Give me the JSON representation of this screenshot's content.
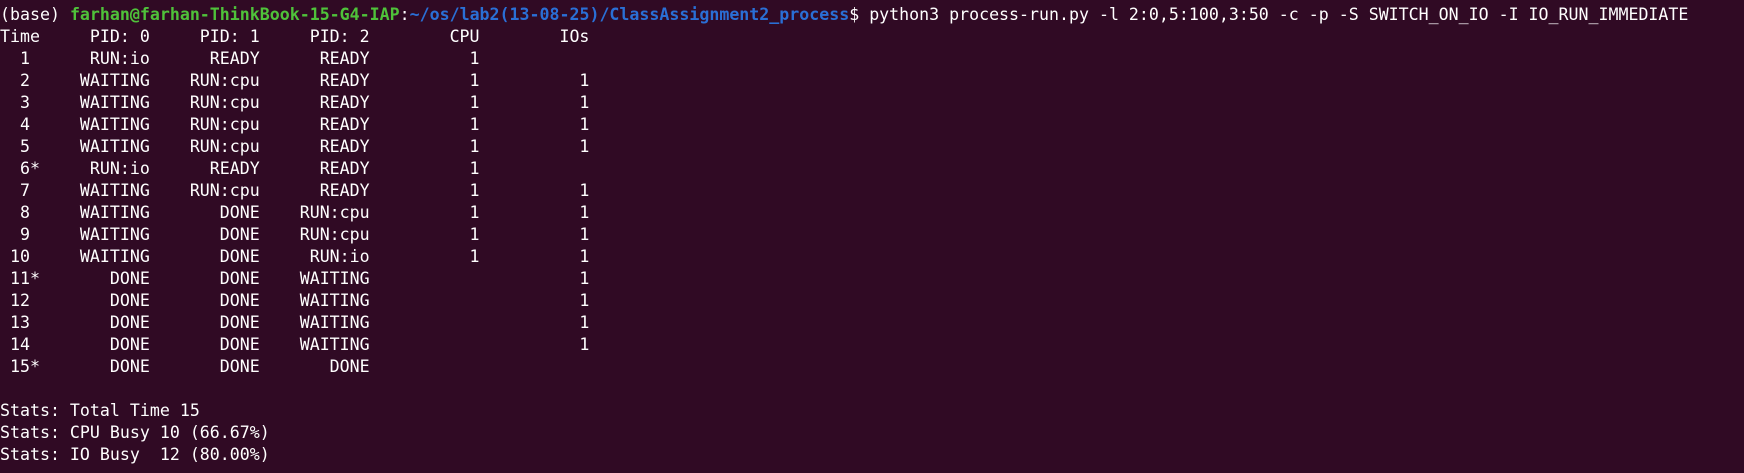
{
  "prompt": {
    "env": "(base) ",
    "user_host": "farhan@farhan-ThinkBook-15-G4-IAP",
    "separator": ":",
    "path": "~/os/lab2(13-08-25)/ClassAssignment2_process",
    "symbol": "$ ",
    "command": "python3 process-run.py -l 2:0,5:100,3:50 -c -p -S SWITCH_ON_IO -I IO_RUN_IMMEDIATE"
  },
  "table": {
    "header": "Time     PID: 0     PID: 1     PID: 2        CPU        IOs",
    "rows": [
      "  1      RUN:io      READY      READY          1",
      "  2     WAITING    RUN:cpu      READY          1          1",
      "  3     WAITING    RUN:cpu      READY          1          1",
      "  4     WAITING    RUN:cpu      READY          1          1",
      "  5     WAITING    RUN:cpu      READY          1          1",
      "  6*     RUN:io      READY      READY          1",
      "  7     WAITING    RUN:cpu      READY          1          1",
      "  8     WAITING       DONE    RUN:cpu          1          1",
      "  9     WAITING       DONE    RUN:cpu          1          1",
      " 10     WAITING       DONE     RUN:io          1          1",
      " 11*       DONE       DONE    WAITING                     1",
      " 12        DONE       DONE    WAITING                     1",
      " 13        DONE       DONE    WAITING                     1",
      " 14        DONE       DONE    WAITING                     1",
      " 15*       DONE       DONE       DONE"
    ]
  },
  "stats": [
    "Stats: Total Time 15",
    "Stats: CPU Busy 10 (66.67%)",
    "Stats: IO Busy  12 (80.00%)"
  ],
  "colors": {
    "background": "#300a24",
    "user_host": "#4fc23a",
    "path": "#2a6fd6",
    "text": "#ffffff"
  }
}
